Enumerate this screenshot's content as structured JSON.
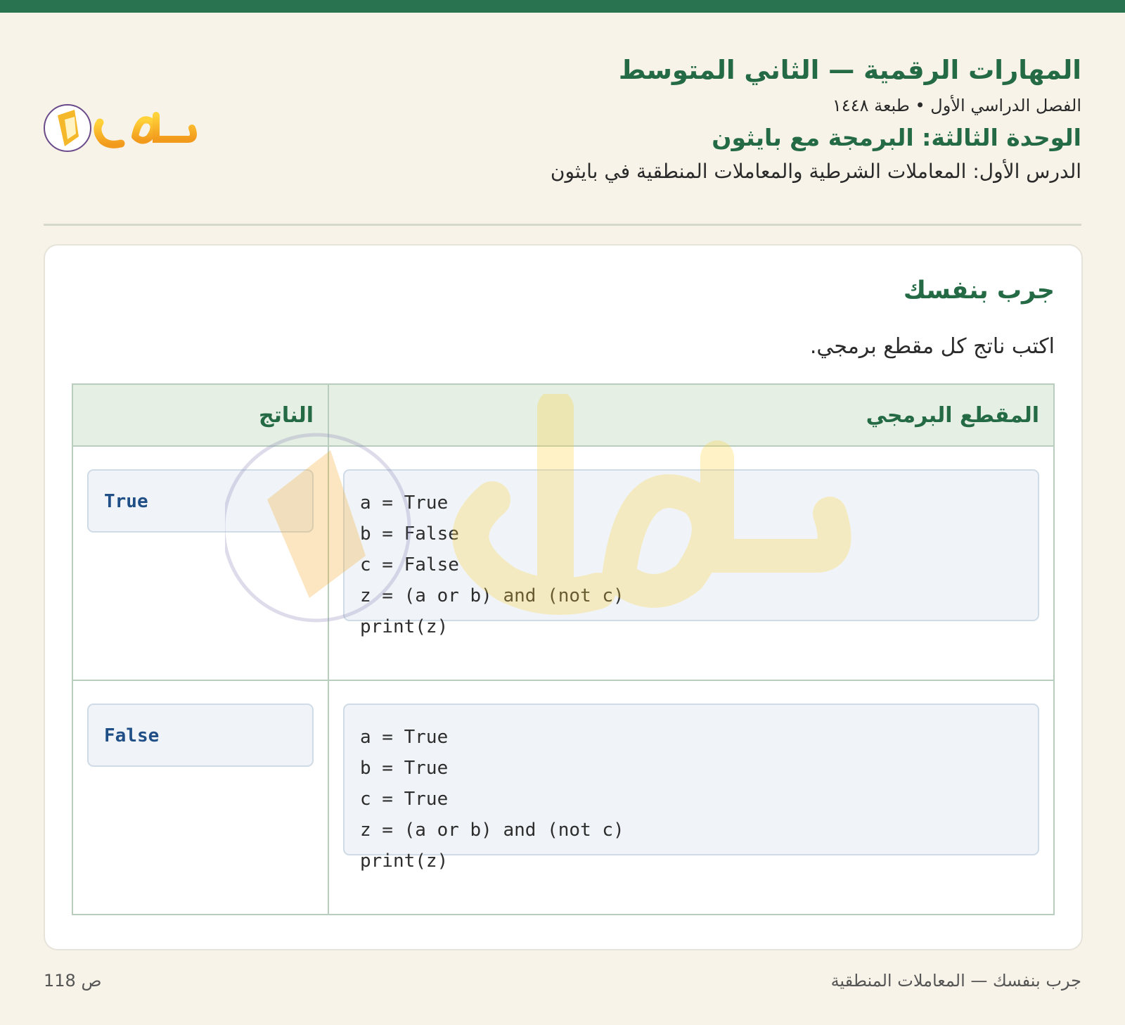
{
  "header": {
    "title": "المهارات الرقمية — الثاني المتوسط",
    "term": "الفصل الدراسي الأول • طبعة ١٤٤٨",
    "unit": "الوحدة الثالثة: البرمجة مع بايثون",
    "lesson": "الدرس الأول: المعاملات الشرطية والمعاملات المنطقية في بايثون",
    "logo_text": "حلول"
  },
  "card": {
    "title": "جرب بنفسك",
    "instruction": "اكتب ناتج كل مقطع برمجي."
  },
  "table": {
    "headers": {
      "code": "المقطع البرمجي",
      "output": "الناتج"
    },
    "rows": [
      {
        "code": [
          "a = True",
          "b = False",
          "c = False",
          "z = (a or b) and (not c)",
          "print(z)"
        ],
        "output": "True"
      },
      {
        "code": [
          "a = True",
          "b = True",
          "c = True",
          "z = (a or b) and (not c)",
          "print(z)"
        ],
        "output": "False"
      }
    ]
  },
  "footer": {
    "section": "جرب بنفسك — المعاملات المنطقية",
    "page": "ص 118"
  },
  "colors": {
    "accent": "#236a45",
    "topbar": "#2a7350",
    "background": "#f7f3e8",
    "code_bg": "#f0f4f8",
    "output_text": "#1f4f86",
    "header_row_bg": "#e5efe3"
  }
}
